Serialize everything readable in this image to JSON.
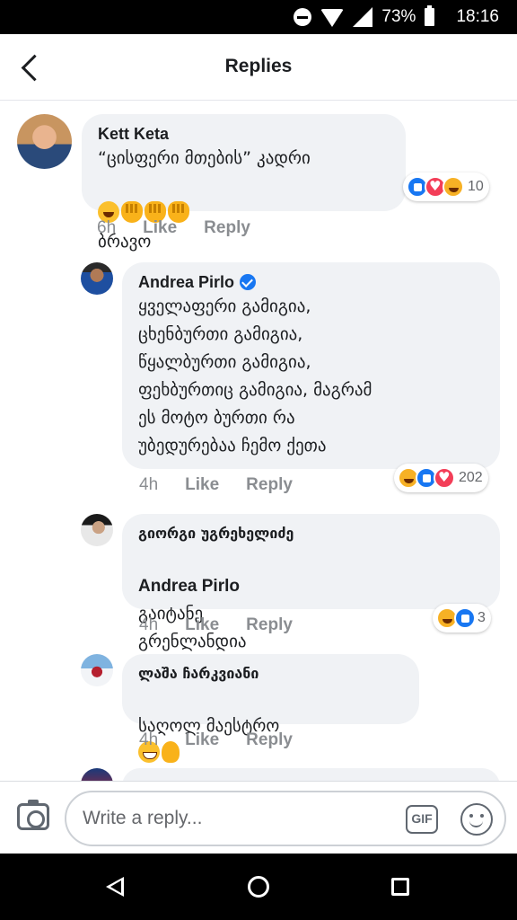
{
  "status_bar": {
    "battery": "73%",
    "time": "18:16"
  },
  "header": {
    "title": "Replies"
  },
  "comments": [
    {
      "author": "Kett Keta",
      "text": "“ცისფერი მთების” კადრი",
      "text2": "ბრავო",
      "emojis": [
        "laughing-emoji",
        "clap-emoji",
        "clap-emoji",
        "clap-emoji"
      ],
      "time": "6h",
      "like": "Like",
      "reply": "Reply",
      "reactions": [
        "like",
        "love",
        "haha"
      ],
      "reaction_count": "10"
    },
    {
      "author": "Andrea Pirlo",
      "verified": true,
      "text": "ყველაფერი გამიგია,\nცხენბურთი გამიგია,\nწყალბურთი გამიგია,\nფეხბურთიც გამიგია, მაგრამ\nეს მოტო ბურთი რა\nუბედურებაა ჩემო ქეთა",
      "time": "4h",
      "like": "Like",
      "reply": "Reply",
      "reactions": [
        "haha",
        "like",
        "love"
      ],
      "reaction_count": "202"
    },
    {
      "author": "გიორგი უგრეხელიძე",
      "mention": "Andrea Pirlo",
      "text": "გაიტანე",
      "text2": "გრენლანდია",
      "time": "4h",
      "like": "Like",
      "reply": "Reply",
      "reactions": [
        "haha",
        "like"
      ],
      "reaction_count": "3"
    },
    {
      "author": "ლაშა ჩარკვიანი",
      "text": "საღოლ მაესტრო",
      "emojis": [
        "grinning-emoji",
        "ok-hand-emoji"
      ],
      "time": "4h",
      "like": "Like",
      "reply": "Reply"
    }
  ],
  "composer": {
    "placeholder": "Write a reply...",
    "gif_label": "GIF"
  },
  "colors": {
    "bubble": "#f0f2f5",
    "accent": "#1877f2",
    "love": "#f33e58",
    "meta": "#8a8d91"
  }
}
